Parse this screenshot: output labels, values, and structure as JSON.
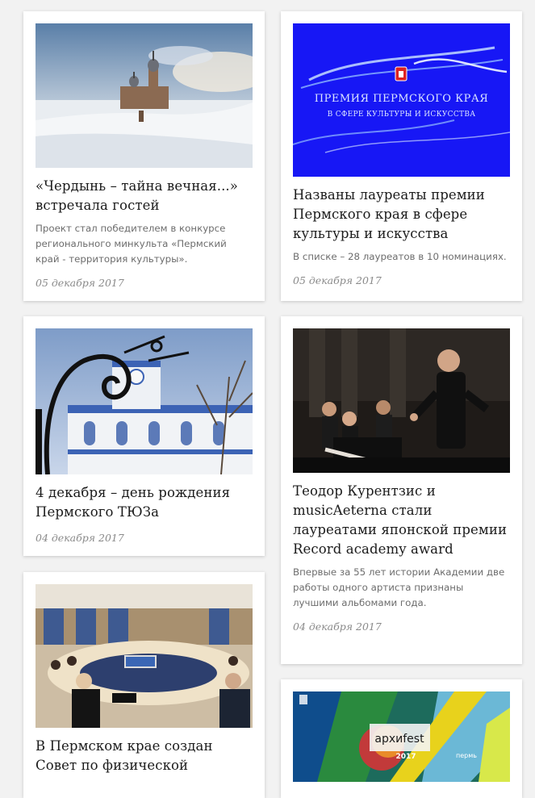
{
  "cards": [
    {
      "title": "«Чердынь – тайна вечная...» встречала гостей",
      "excerpt": "Проект стал победителем в конкурсе регионального минкульта «Пермский край - территория культуры».",
      "date": "05 декабря 2017"
    },
    {
      "image_text_line1": "ПРЕМИЯ ПЕРМСКОГО КРАЯ",
      "image_text_line2": "В СФЕРЕ КУЛЬТУРЫ И ИСКУССТВА",
      "title": "Названы лауреаты премии Пермского края в сфере культуры и искусства",
      "excerpt": "В списке – 28 лауреатов в 10 номинациях.",
      "date": "05 декабря 2017"
    },
    {
      "title": "4 декабря – день рождения Пермского ТЮЗа",
      "date": "04 декабря 2017"
    },
    {
      "title": "Теодор Курентзис и musicAeterna стали лауреатами японской премии Record academy award",
      "excerpt": "Впервые за 55 лет истории Академии две работы одного артиста признаны лучшими альбомами года.",
      "date": "04 декабря 2017"
    },
    {
      "title": "В Пермском крае создан Совет по физической"
    },
    {
      "image_text_main": "архиfest",
      "image_text_year": "2017",
      "image_text_city": "пермь"
    }
  ],
  "colors": {
    "page_background": "#f2f2f2",
    "card_background": "#ffffff",
    "title_text": "#1b1b1b",
    "excerpt_text": "#6d6d6d",
    "date_text": "#8a8a8a",
    "premium_banner_blue": "#1a1aff"
  }
}
